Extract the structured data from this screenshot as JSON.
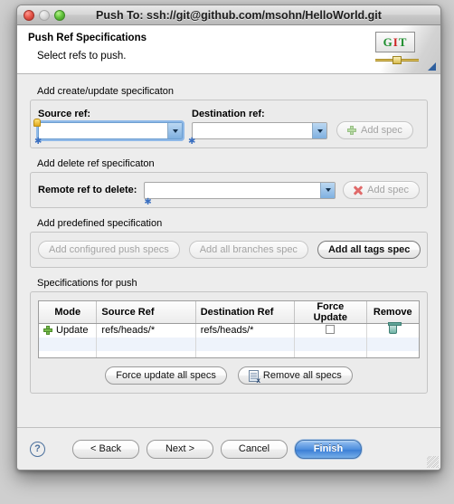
{
  "window": {
    "title": "Push To: ssh://git@github.com/msohn/HelloWorld.git",
    "traffic": {
      "close": "close-button",
      "minimize": "minimize-button",
      "zoom": "zoom-button"
    }
  },
  "header": {
    "title": "Push Ref Specifications",
    "subtitle": "Select refs to push.",
    "logo": {
      "g": "G",
      "i": "I",
      "t": "T"
    }
  },
  "create_update_group": {
    "legend": "Add create/update specificaton",
    "source_label": "Source ref:",
    "source_value": "",
    "destination_label": "Destination ref:",
    "destination_value": "",
    "add_spec_label": "Add spec"
  },
  "delete_group": {
    "legend": "Add delete ref specificaton",
    "remote_label": "Remote ref to delete:",
    "remote_value": "",
    "add_spec_label": "Add spec"
  },
  "predefined_group": {
    "legend": "Add predefined specification",
    "configured_label": "Add configured push specs",
    "branches_label": "Add all branches spec",
    "tags_label": "Add all tags spec"
  },
  "specs_group": {
    "legend": "Specifications for push",
    "columns": [
      "Mode",
      "Source Ref",
      "Destination Ref",
      "Force Update",
      "Remove"
    ],
    "rows": [
      {
        "mode": "Update",
        "source_ref": "refs/heads/*",
        "destination_ref": "refs/heads/*",
        "force_update": false,
        "remove": "trash-icon"
      }
    ],
    "force_update_all_label": "Force update all specs",
    "remove_all_label": "Remove all specs"
  },
  "footer": {
    "help": "?",
    "back": "< Back",
    "next": "Next >",
    "cancel": "Cancel",
    "finish": "Finish"
  }
}
